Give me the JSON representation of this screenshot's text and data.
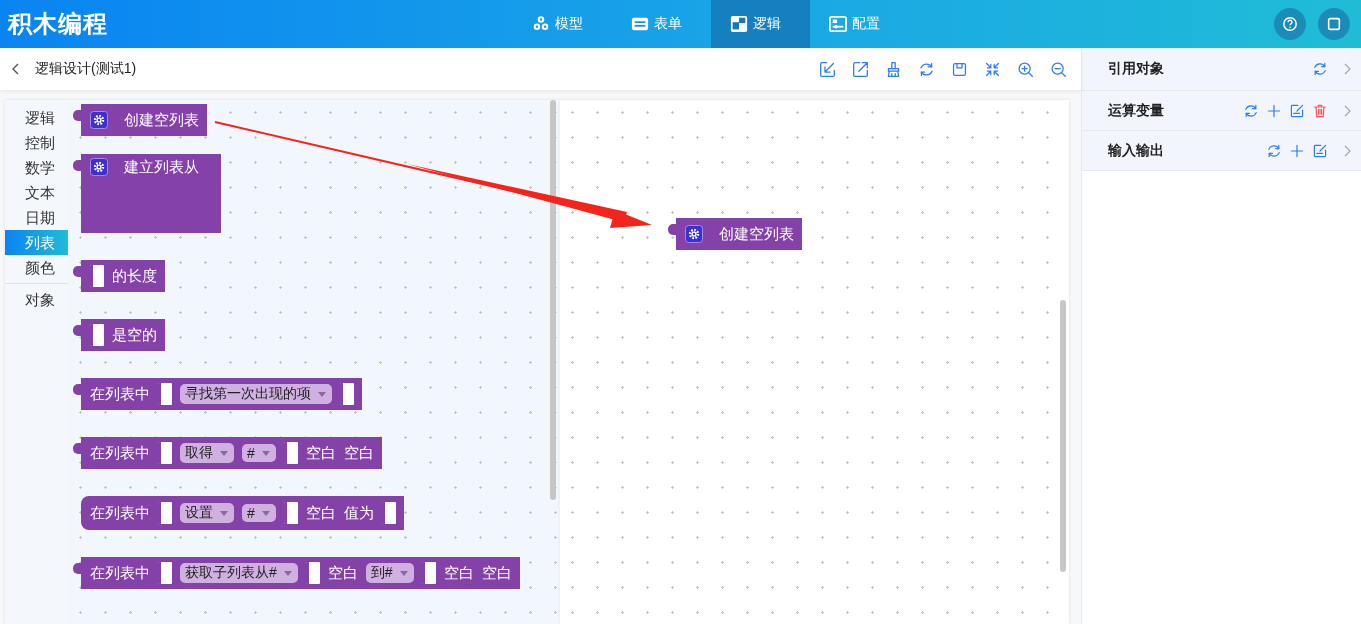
{
  "app": {
    "title": "积木编程"
  },
  "nav": [
    {
      "kind": "model",
      "label": "模型",
      "selected": false
    },
    {
      "kind": "form",
      "label": "表单",
      "selected": false
    },
    {
      "kind": "logic",
      "label": "逻辑",
      "selected": true
    },
    {
      "kind": "config",
      "label": "配置",
      "selected": false
    }
  ],
  "header_actions": [
    {
      "kind": "help"
    },
    {
      "kind": "window"
    }
  ],
  "page": {
    "title": "逻辑设计(测试1)"
  },
  "toolbar": [
    {
      "kind": "import"
    },
    {
      "kind": "export"
    },
    {
      "kind": "brush"
    },
    {
      "kind": "refresh"
    },
    {
      "kind": "save"
    },
    {
      "kind": "collapse"
    },
    {
      "kind": "zoom-in"
    },
    {
      "kind": "zoom-out"
    }
  ],
  "categories": [
    {
      "label": "逻辑",
      "selected": false,
      "separated": false
    },
    {
      "label": "控制",
      "selected": false,
      "separated": false
    },
    {
      "label": "数学",
      "selected": false,
      "separated": false
    },
    {
      "label": "文本",
      "selected": false,
      "separated": false
    },
    {
      "label": "日期",
      "selected": false,
      "separated": false
    },
    {
      "label": "列表",
      "selected": true,
      "separated": false
    },
    {
      "label": "颜色",
      "selected": false,
      "separated": false
    },
    {
      "label": "对象",
      "selected": false,
      "separated": true
    }
  ],
  "flyout_blocks": [
    {
      "kind": "value",
      "parts": [
        {
          "kind": "gear"
        },
        {
          "kind": "label",
          "text": "创建空列表"
        }
      ]
    },
    {
      "kind": "tall",
      "parts": [
        {
          "kind": "gear"
        },
        {
          "kind": "label",
          "text": "建立列表从"
        }
      ]
    },
    {
      "kind": "value",
      "parts": [
        {
          "kind": "socket"
        },
        {
          "kind": "label",
          "text": "的长度"
        }
      ]
    },
    {
      "kind": "value",
      "parts": [
        {
          "kind": "socket"
        },
        {
          "kind": "label",
          "text": "是空的"
        }
      ]
    },
    {
      "kind": "value",
      "parts": [
        {
          "kind": "label",
          "text": "在列表中"
        },
        {
          "kind": "socket"
        },
        {
          "kind": "dropdown",
          "text": "寻找第一次出现的项"
        },
        {
          "kind": "socket"
        }
      ]
    },
    {
      "kind": "value",
      "parts": [
        {
          "kind": "label",
          "text": "在列表中"
        },
        {
          "kind": "socket"
        },
        {
          "kind": "dropdown",
          "text": "取得"
        },
        {
          "kind": "dropdown",
          "text": "#"
        },
        {
          "kind": "socket"
        },
        {
          "kind": "label",
          "text": "空白"
        },
        {
          "kind": "label",
          "text": "空白"
        }
      ]
    },
    {
      "kind": "statement",
      "parts": [
        {
          "kind": "label",
          "text": "在列表中"
        },
        {
          "kind": "socket"
        },
        {
          "kind": "dropdown",
          "text": "设置"
        },
        {
          "kind": "dropdown",
          "text": "#"
        },
        {
          "kind": "socket"
        },
        {
          "kind": "label",
          "text": "空白"
        },
        {
          "kind": "label",
          "text": "值为"
        },
        {
          "kind": "socket"
        }
      ]
    },
    {
      "kind": "value",
      "parts": [
        {
          "kind": "label",
          "text": "在列表中"
        },
        {
          "kind": "socket"
        },
        {
          "kind": "dropdown",
          "text": "获取子列表从#"
        },
        {
          "kind": "socket"
        },
        {
          "kind": "label",
          "text": "空白"
        },
        {
          "kind": "dropdown",
          "text": "到#"
        },
        {
          "kind": "socket"
        },
        {
          "kind": "label",
          "text": "空白"
        },
        {
          "kind": "label",
          "text": "空白"
        }
      ]
    }
  ],
  "canvas_blocks": [
    {
      "kind": "value",
      "parts": [
        {
          "kind": "gear"
        },
        {
          "kind": "label",
          "text": "创建空列表"
        }
      ]
    }
  ],
  "panel_sections": [
    {
      "title": "引用对象",
      "actions": [
        {
          "kind": "refresh"
        }
      ]
    },
    {
      "title": "运算变量",
      "actions": [
        {
          "kind": "refresh"
        },
        {
          "kind": "add"
        },
        {
          "kind": "edit"
        },
        {
          "kind": "delete"
        }
      ]
    },
    {
      "title": "输入输出",
      "actions": [
        {
          "kind": "refresh"
        },
        {
          "kind": "add"
        },
        {
          "kind": "edit"
        }
      ]
    }
  ]
}
